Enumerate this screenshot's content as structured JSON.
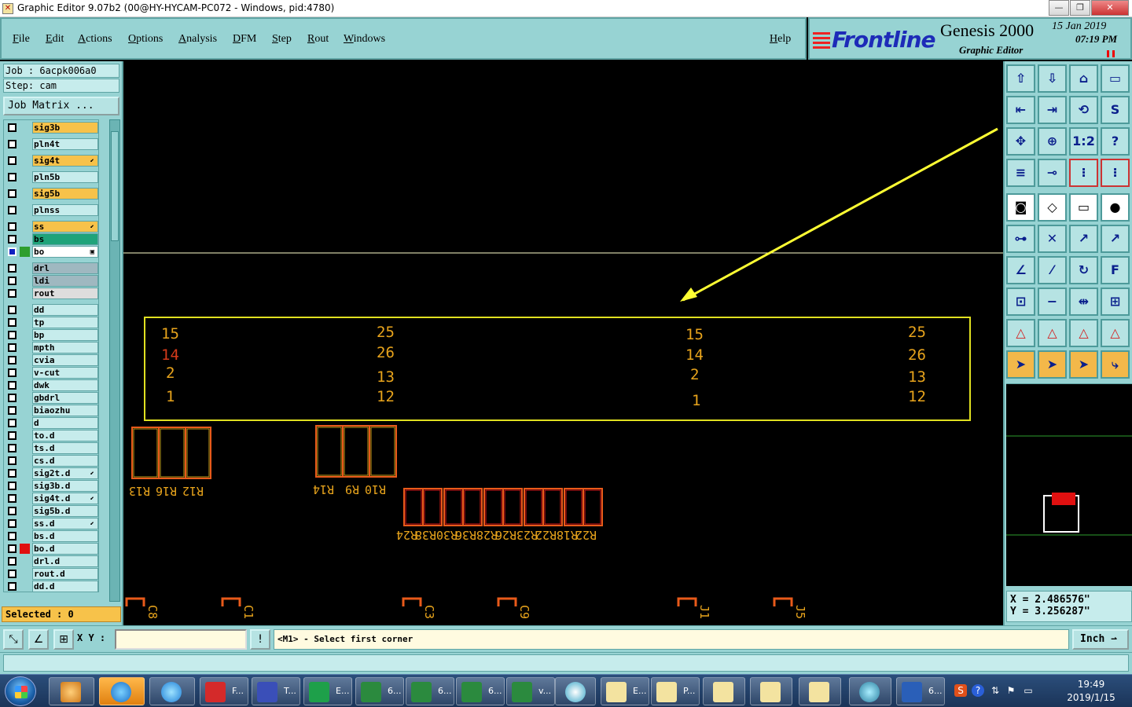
{
  "window": {
    "title": "Graphic Editor 9.07b2 (00@HY-HYCAM-PC072 - Windows, pid:4780)",
    "minimize": "—",
    "maximize": "❐",
    "close": "✕"
  },
  "menu": {
    "items": [
      "File",
      "Edit",
      "Actions",
      "Options",
      "Analysis",
      "DFM",
      "Step",
      "Rout",
      "Windows"
    ],
    "help": "Help"
  },
  "brand": {
    "logo": "Frontline",
    "product": "Genesis 2000",
    "subtitle": "Graphic Editor",
    "date": "15 Jan 2019",
    "time": "07:19 PM"
  },
  "left": {
    "job": "Job : 6acpk006a0",
    "step": "Step: cam",
    "job_matrix": "Job Matrix ...",
    "layers": [
      {
        "name": "sig3b",
        "bg": "#f7c24a",
        "edit": ""
      },
      {
        "name": "pln4t",
        "bg": "#c6ecec",
        "edit": ""
      },
      {
        "name": "sig4t",
        "bg": "#f7c24a",
        "edit": "⬋"
      },
      {
        "name": "pln5b",
        "bg": "#c6ecec",
        "edit": ""
      },
      {
        "name": "sig5b",
        "bg": "#f7c24a",
        "edit": ""
      },
      {
        "name": "plnss",
        "bg": "#c6ecec",
        "edit": ""
      },
      {
        "name": "ss",
        "bg": "#f7c24a",
        "edit": "⬋"
      },
      {
        "name": "bs",
        "bg": "#1fa37a",
        "edit": ""
      },
      {
        "name": "bo",
        "bg": "#ffffff",
        "edit": "▣",
        "marker": "#2e9e2e",
        "cb": "#1020c0"
      },
      {
        "name": "drl",
        "bg": "#9fb8c0",
        "edit": ""
      },
      {
        "name": "ldi",
        "bg": "#9fb8c0",
        "edit": ""
      },
      {
        "name": "rout",
        "bg": "#dddddd",
        "edit": ""
      },
      {
        "name": "dd",
        "bg": "#c6ecec",
        "edit": ""
      },
      {
        "name": "tp",
        "bg": "#c6ecec",
        "edit": ""
      },
      {
        "name": "bp",
        "bg": "#c6ecec",
        "edit": ""
      },
      {
        "name": "mpth",
        "bg": "#c6ecec",
        "edit": ""
      },
      {
        "name": "cvia",
        "bg": "#c6ecec",
        "edit": ""
      },
      {
        "name": "v-cut",
        "bg": "#c6ecec",
        "edit": ""
      },
      {
        "name": "dwk",
        "bg": "#c6ecec",
        "edit": ""
      },
      {
        "name": "gbdrl",
        "bg": "#c6ecec",
        "edit": ""
      },
      {
        "name": "biaozhu",
        "bg": "#c6ecec",
        "edit": ""
      },
      {
        "name": "d",
        "bg": "#c6ecec",
        "edit": ""
      },
      {
        "name": "to.d",
        "bg": "#c6ecec",
        "edit": ""
      },
      {
        "name": "ts.d",
        "bg": "#c6ecec",
        "edit": ""
      },
      {
        "name": "cs.d",
        "bg": "#c6ecec",
        "edit": ""
      },
      {
        "name": "sig2t.d",
        "bg": "#c6ecec",
        "edit": "⬋"
      },
      {
        "name": "sig3b.d",
        "bg": "#c6ecec",
        "edit": ""
      },
      {
        "name": "sig4t.d",
        "bg": "#c6ecec",
        "edit": "⬋"
      },
      {
        "name": "sig5b.d",
        "bg": "#c6ecec",
        "edit": ""
      },
      {
        "name": "ss.d",
        "bg": "#c6ecec",
        "edit": "⬋"
      },
      {
        "name": "bs.d",
        "bg": "#c6ecec",
        "edit": ""
      },
      {
        "name": "bo.d",
        "bg": "#c6ecec",
        "edit": "",
        "marker": "#e01010"
      },
      {
        "name": "drl.d",
        "bg": "#c6ecec",
        "edit": ""
      },
      {
        "name": "rout.d",
        "bg": "#c6ecec",
        "edit": ""
      },
      {
        "name": "dd.d",
        "bg": "#c6ecec",
        "edit": ""
      }
    ],
    "selected": "Selected : 0"
  },
  "canvas": {
    "numbers": [
      "15",
      "14",
      "2",
      "1",
      "25",
      "26",
      "13",
      "12",
      "15",
      "14",
      "2",
      "1",
      "25",
      "26",
      "13",
      "12"
    ],
    "refdes_group1": [
      "R13",
      "R16",
      "R12"
    ],
    "refdes_group2": [
      "R14",
      "R9",
      "R10"
    ],
    "refdes_group3": [
      "R24",
      "R38",
      "R30",
      "R36",
      "R28",
      "R26",
      "R23",
      "R22",
      "R18",
      "R22"
    ],
    "bottom_labels": [
      "C8",
      "C1",
      "C3",
      "C9",
      "J1",
      "J5"
    ]
  },
  "right": {
    "tools": [
      "⇧",
      "⇩",
      "⌂",
      "▭",
      "⇤",
      "⇥",
      "⟲",
      "S",
      "✥",
      "⊕",
      "1:2",
      "?",
      "≡",
      "⊸",
      "⁝",
      "⁝",
      "◙",
      "◇",
      "▭",
      "●",
      "⊶",
      "✕",
      "↗",
      "↗",
      "∠",
      "⁄",
      "↻",
      "F",
      "⊡",
      "−",
      "⇹",
      "⊞",
      "△",
      "△",
      "△",
      "△",
      "➤",
      "➤",
      "➤",
      "⤷"
    ],
    "x": "X = 2.486576\"",
    "y": "Y = 3.256287\""
  },
  "status": {
    "xy_label": "X Y :",
    "xy_value": "",
    "prompt": "<M1> - Select first corner",
    "units": "Inch ⇀",
    "warn": "!"
  },
  "taskbar": {
    "items": [
      "F...",
      "T...",
      "E...",
      "6...",
      "6...",
      "6...",
      "v...",
      "E...",
      "P...",
      "6..."
    ],
    "time": "19:49",
    "date": "2019/1/15"
  }
}
